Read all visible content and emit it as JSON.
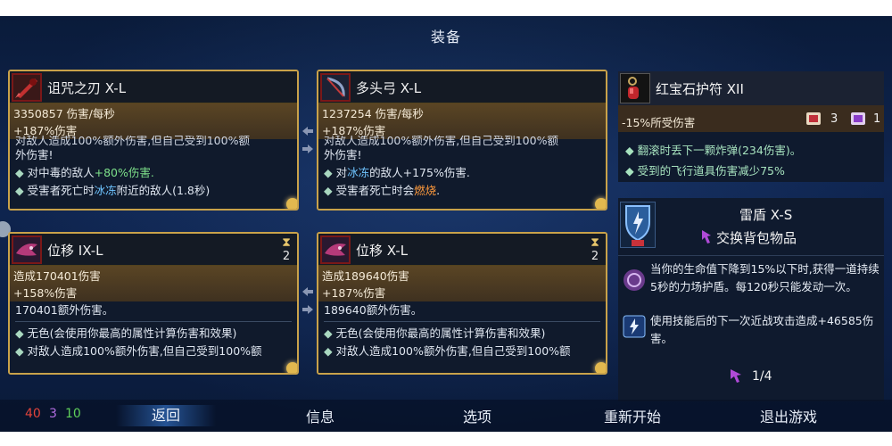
{
  "title": "装备",
  "cards": [
    {
      "name": "诅咒之刃 X-L",
      "dps": "3350857 伤害/每秒",
      "dmg": "+187%伤害",
      "cut_line": "对敌人造成100%额外伤害,但自己受到100%额",
      "desc": [
        "外伤害!"
      ],
      "bullets": [
        {
          "pre": "对中毒的敌人",
          "hl": "+80%伤害.",
          "post": ""
        },
        {
          "pre": "受害者死亡时",
          "hl": "冰冻",
          "post": "附近的敌人(1.8秒)"
        }
      ],
      "icon": "cursed-blade-icon"
    },
    {
      "name": "多头弓 X-L",
      "dps": "1237254 伤害/每秒",
      "dmg": "+187%伤害",
      "cut_line": "对敌人造成100%额外伤害,但自己受到100%额",
      "desc": [
        "外伤害!"
      ],
      "bullets": [
        {
          "pre": "对",
          "hl": "冰冻",
          "post": "的敌人+175%伤害."
        },
        {
          "pre": "受害者死亡时会",
          "hl": "燃烧",
          "post": "."
        }
      ],
      "icon": "multi-bow-icon"
    },
    {
      "name": "位移 IX-L",
      "timer": "2",
      "dps": "造成170401伤害",
      "dmg": "+158%伤害",
      "line1": "170401额外伤害。",
      "bullet": "无色(会使用你最高的属性计算伤害和效果)",
      "tail": "对敌人造成100%额外伤害,但自己受到100%额",
      "icon": "displacement-icon"
    },
    {
      "name": "位移 X-L",
      "timer": "2",
      "dps": "造成189640伤害",
      "dmg": "+187%伤害",
      "line1": "189640额外伤害。",
      "bullet": "无色(会使用你最高的属性计算伤害和效果)",
      "tail": "对敌人造成100%额外伤害,但自己受到100%额",
      "icon": "displacement-icon"
    }
  ],
  "amulet": {
    "name": "红宝石护符 XII",
    "stat": "-15%所受伤害",
    "scroll_red": "3",
    "scroll_purple": "1",
    "line1": "翻滚时丢下一颗炸弹(234伤害)。",
    "line2": "受到的飞行道具伤害减少75%",
    "icon": "ruby-amulet-icon"
  },
  "shield": {
    "name": "雷盾 X-S",
    "swap": "交换背包物品",
    "ability1": "当你的生命值下降到15%以下时,获得一道持续5秒的力场护盾。每120秒只能发动一次。",
    "ability2": "使用技能后的下一次近战攻击造成+46585伤害。",
    "charges": "1/4",
    "icon": "thunder-shield-icon"
  },
  "resources": {
    "red": "40",
    "purple": "3",
    "green": "10"
  },
  "menu": {
    "back": "返回",
    "info": "信息",
    "options": "选项",
    "restart": "重新开始",
    "quit": "退出游戏"
  }
}
